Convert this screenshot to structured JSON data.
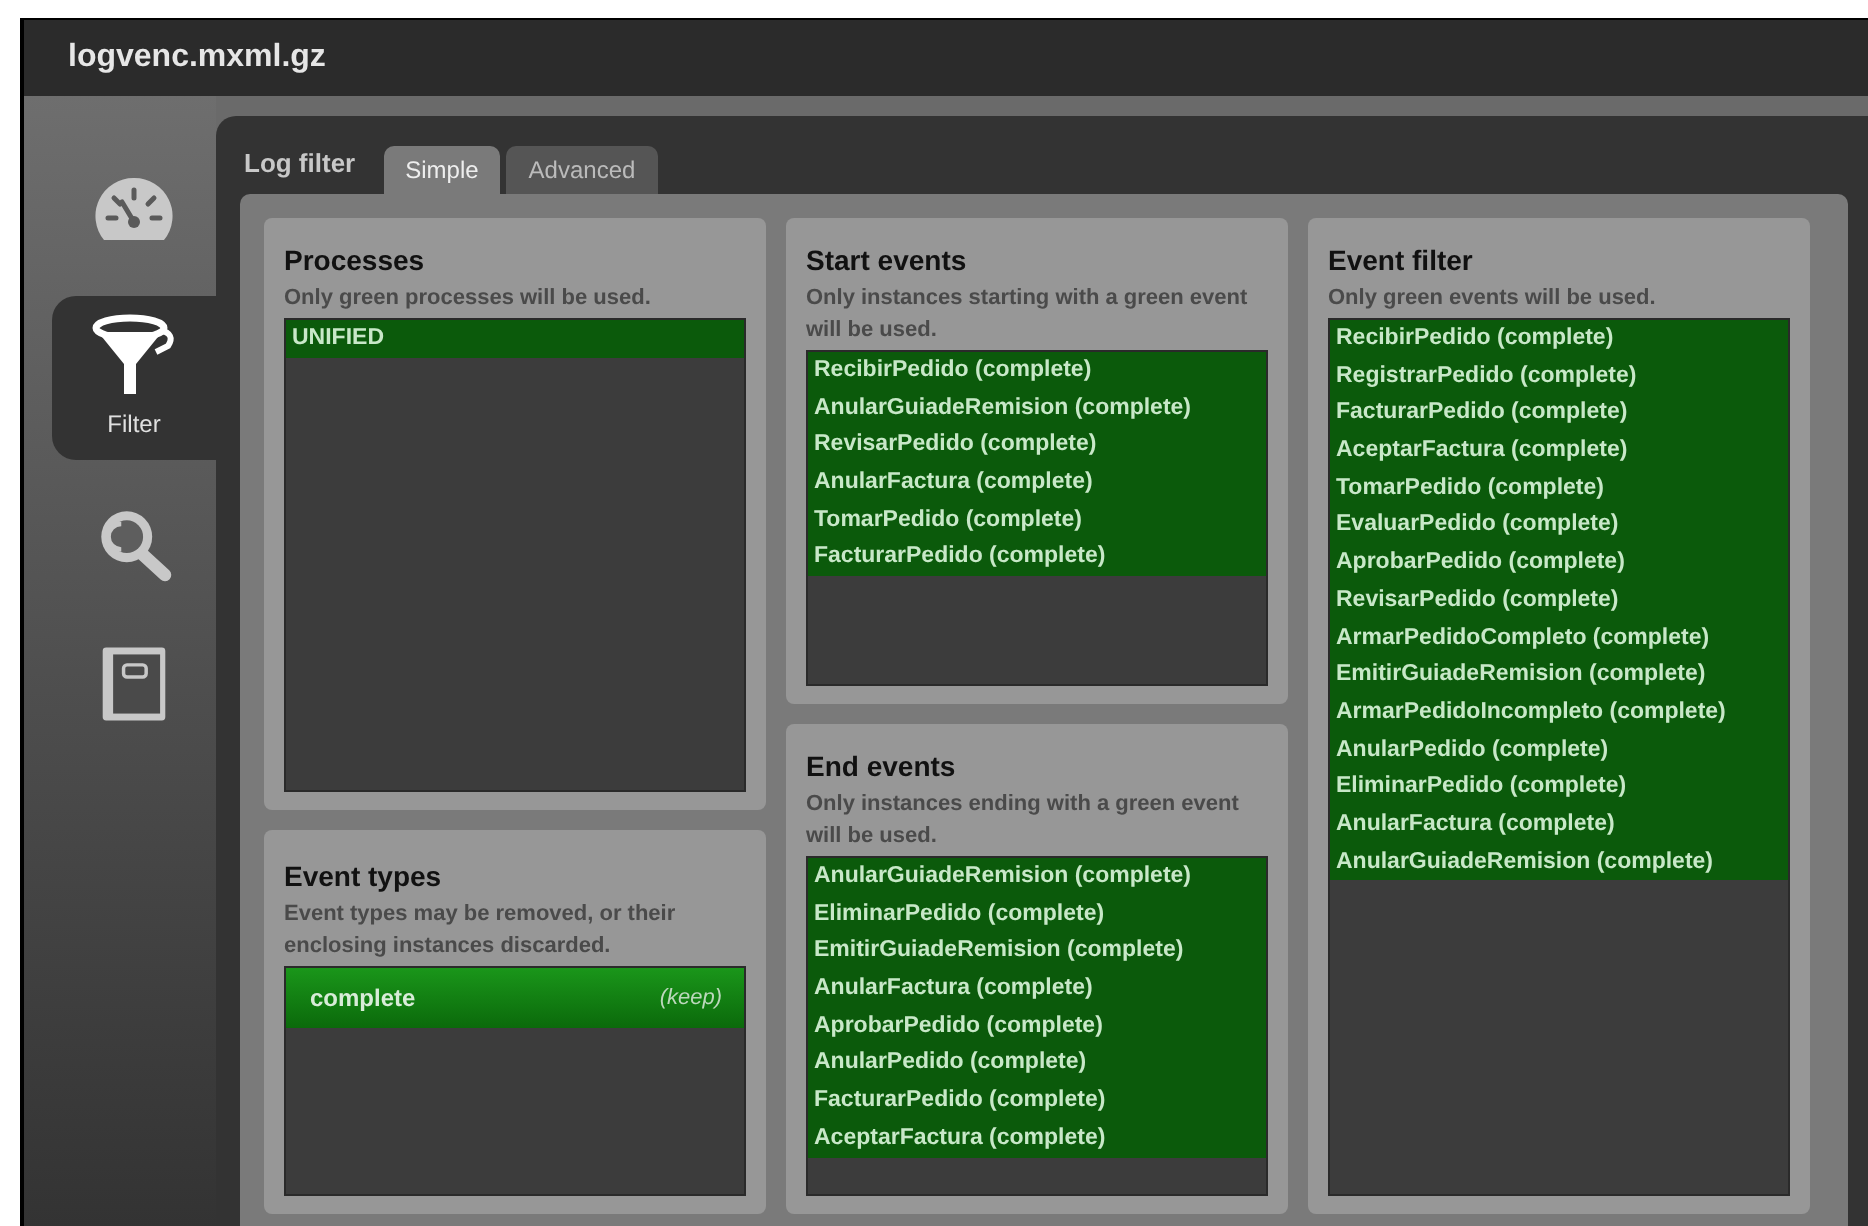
{
  "window": {
    "title": "logvenc.mxml.gz"
  },
  "sidebar": {
    "items": [
      {
        "kind": "gauge",
        "selected": false
      },
      {
        "kind": "funnel",
        "label": "Filter",
        "selected": true
      },
      {
        "kind": "search",
        "selected": false
      },
      {
        "kind": "book",
        "selected": false
      }
    ]
  },
  "panel": {
    "title": "Log filter",
    "tabs": [
      {
        "label": "Simple",
        "selected": true
      },
      {
        "label": "Advanced",
        "selected": false
      }
    ]
  },
  "processes": {
    "title": "Processes",
    "hint": "Only green processes will be used.",
    "items": [
      {
        "label": "UNIFIED",
        "included": true
      }
    ]
  },
  "event_types": {
    "title": "Event types",
    "hint": "Event types may be removed, or their enclosing instances discarded.",
    "items": [
      {
        "label": "complete",
        "action": "(keep)",
        "included": true
      }
    ]
  },
  "start_events": {
    "title": "Start events",
    "hint": "Only instances starting with a green event will be used.",
    "items": [
      {
        "label": "RecibirPedido (complete)",
        "included": true
      },
      {
        "label": "AnularGuiadeRemision (complete)",
        "included": true
      },
      {
        "label": "RevisarPedido (complete)",
        "included": true
      },
      {
        "label": "AnularFactura (complete)",
        "included": true
      },
      {
        "label": "TomarPedido (complete)",
        "included": true
      },
      {
        "label": "FacturarPedido (complete)",
        "included": true
      }
    ]
  },
  "end_events": {
    "title": "End events",
    "hint": "Only instances ending with a green event will be used.",
    "items": [
      {
        "label": "AnularGuiadeRemision (complete)",
        "included": true
      },
      {
        "label": "EliminarPedido (complete)",
        "included": true
      },
      {
        "label": "EmitirGuiadeRemision (complete)",
        "included": true
      },
      {
        "label": "AnularFactura (complete)",
        "included": true
      },
      {
        "label": "AprobarPedido (complete)",
        "included": true
      },
      {
        "label": "AnularPedido (complete)",
        "included": true
      },
      {
        "label": "FacturarPedido (complete)",
        "included": true
      },
      {
        "label": "AceptarFactura (complete)",
        "included": true
      }
    ]
  },
  "event_filter": {
    "title": "Event filter",
    "hint": "Only green events will be used.",
    "items": [
      {
        "label": "RecibirPedido (complete)",
        "included": true
      },
      {
        "label": "RegistrarPedido (complete)",
        "included": true
      },
      {
        "label": "FacturarPedido (complete)",
        "included": true
      },
      {
        "label": "AceptarFactura (complete)",
        "included": true
      },
      {
        "label": "TomarPedido (complete)",
        "included": true
      },
      {
        "label": "EvaluarPedido (complete)",
        "included": true
      },
      {
        "label": "AprobarPedido (complete)",
        "included": true
      },
      {
        "label": "RevisarPedido (complete)",
        "included": true
      },
      {
        "label": "ArmarPedidoCompleto (complete)",
        "included": true
      },
      {
        "label": "EmitirGuiadeRemision (complete)",
        "included": true
      },
      {
        "label": "ArmarPedidoIncompleto (complete)",
        "included": true
      },
      {
        "label": "AnularPedido (complete)",
        "included": true
      },
      {
        "label": "EliminarPedido (complete)",
        "included": true
      },
      {
        "label": "AnularFactura (complete)",
        "included": true
      },
      {
        "label": "AnularGuiadeRemision (complete)",
        "included": true
      }
    ]
  }
}
